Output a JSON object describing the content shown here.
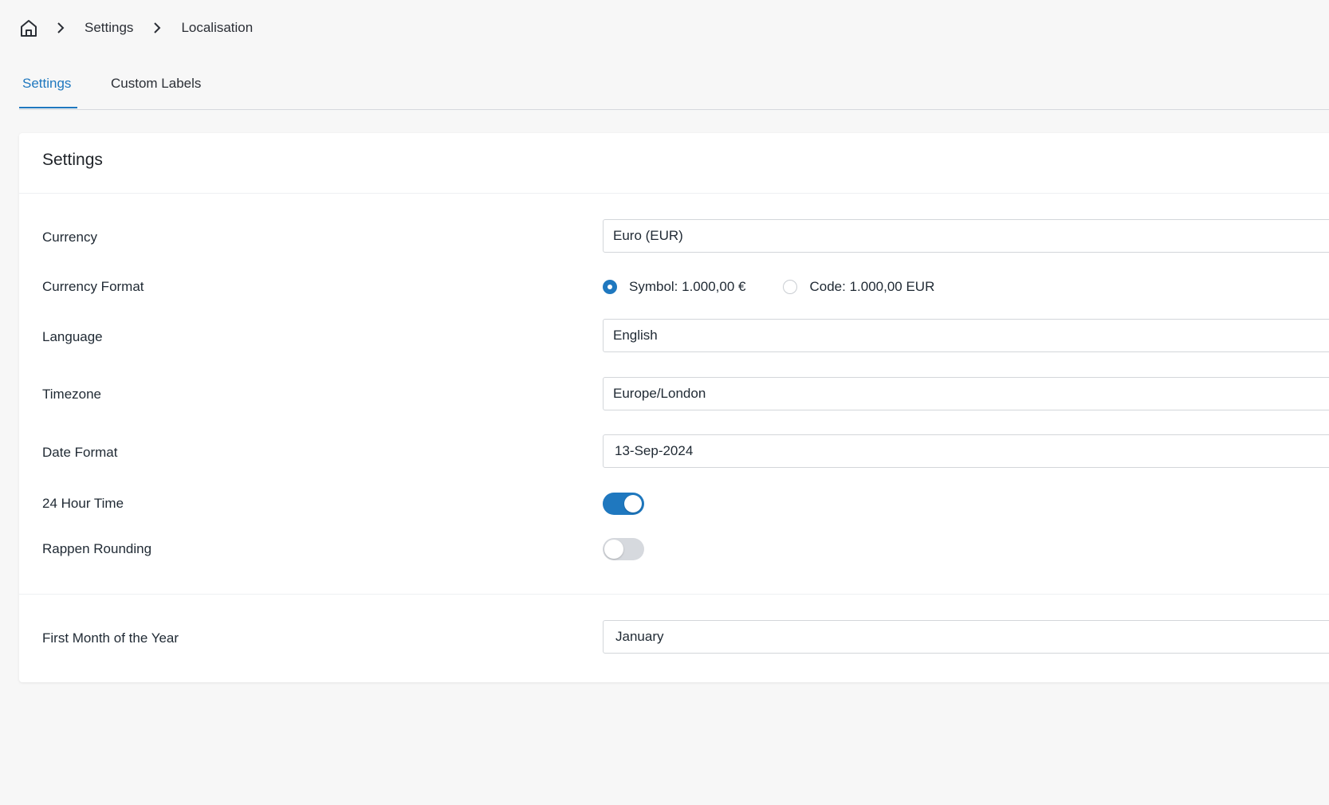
{
  "breadcrumb": {
    "home_icon": "home-icon",
    "separator_icon": "chevron-right-icon",
    "items": [
      "Settings",
      "Localisation"
    ]
  },
  "tabs": [
    {
      "label": "Settings",
      "active": true
    },
    {
      "label": "Custom Labels",
      "active": false
    }
  ],
  "card": {
    "title": "Settings",
    "currency": {
      "label": "Currency",
      "value": "Euro (EUR)"
    },
    "currency_format": {
      "label": "Currency Format",
      "options": [
        {
          "label": "Symbol: 1.000,00 €",
          "checked": true
        },
        {
          "label": "Code: 1.000,00 EUR",
          "checked": false
        }
      ]
    },
    "language": {
      "label": "Language",
      "value": "English"
    },
    "timezone": {
      "label": "Timezone",
      "value": "Europe/London"
    },
    "date_format": {
      "label": "Date Format",
      "value": "13-Sep-2024"
    },
    "hour_24": {
      "label": "24 Hour Time",
      "on": true
    },
    "rappen_rounding": {
      "label": "Rappen Rounding",
      "on": false
    },
    "first_month": {
      "label": "First Month of the Year",
      "value": "January"
    }
  },
  "colors": {
    "accent": "#1f78bf",
    "background": "#f7f7f7",
    "card": "#ffffff",
    "toggle_off": "#d6d9de"
  }
}
